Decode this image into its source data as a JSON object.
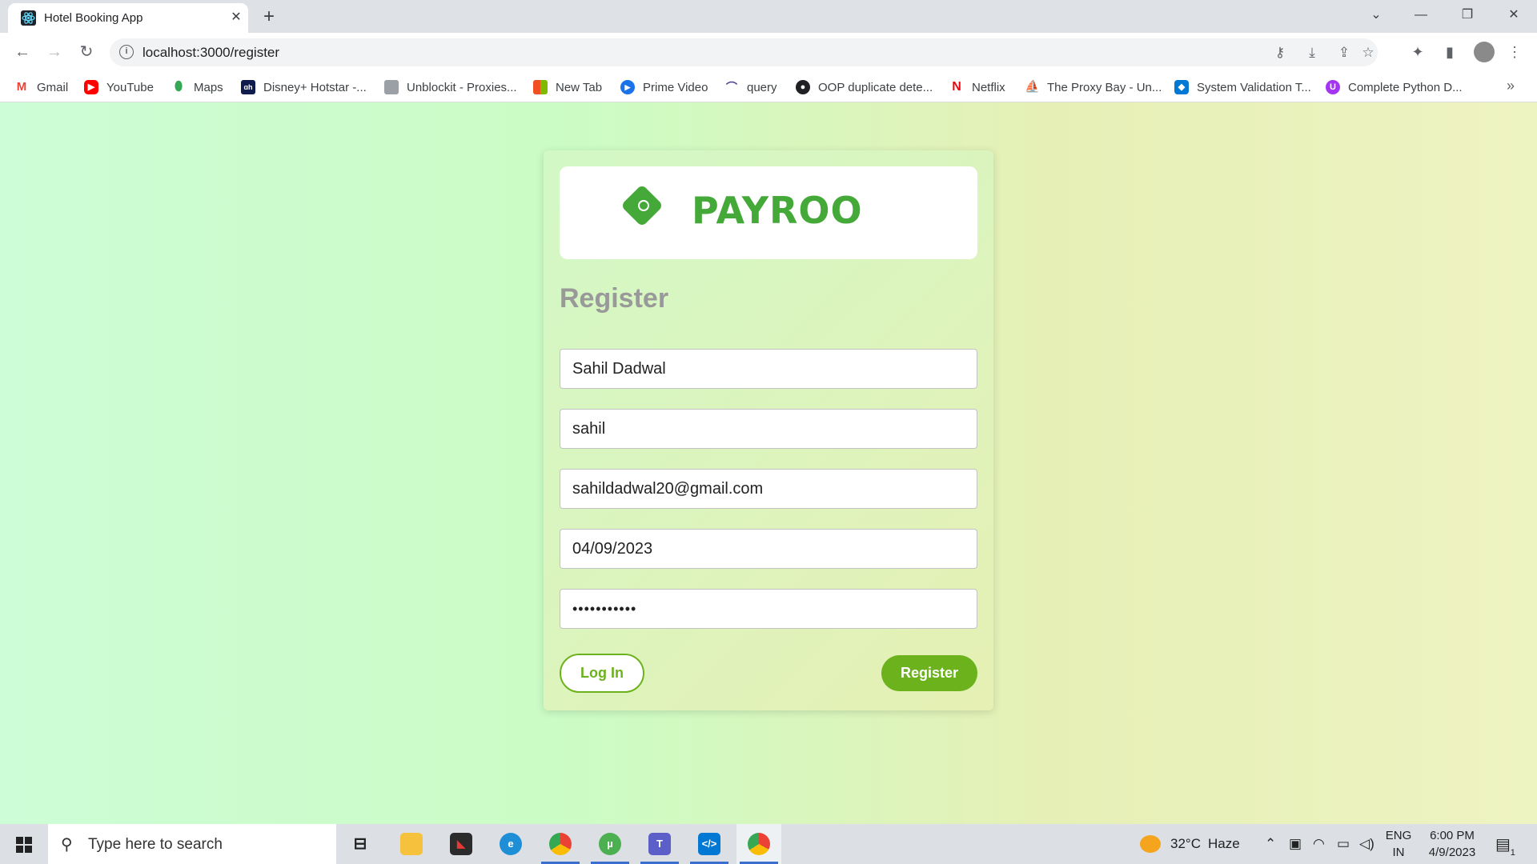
{
  "browser": {
    "tab_title": "Hotel Booking App",
    "url": "localhost:3000/register",
    "bookmarks": [
      {
        "label": "Gmail",
        "icon": "gmail-icon",
        "color": "#ea4335"
      },
      {
        "label": "YouTube",
        "icon": "youtube-icon",
        "color": "#ff0000"
      },
      {
        "label": "Maps",
        "icon": "maps-icon",
        "color": "#34a853"
      },
      {
        "label": "Disney+ Hotstar -...",
        "icon": "hotstar-icon",
        "color": "#0f1c4d"
      },
      {
        "label": "Unblockit - Proxies...",
        "icon": "unblockit-icon",
        "color": "#9aa0a6"
      },
      {
        "label": "New Tab",
        "icon": "windows-tiles-icon",
        "color": "#00a4ef"
      },
      {
        "label": "Prime Video",
        "icon": "prime-video-icon",
        "color": "#1a73e8"
      },
      {
        "label": "query",
        "icon": "query-icon",
        "color": "#4b3b8f"
      },
      {
        "label": "OOP duplicate dete...",
        "icon": "github-icon",
        "color": "#202124"
      },
      {
        "label": "Netflix",
        "icon": "netflix-icon",
        "color": "#e50914"
      },
      {
        "label": "The Proxy Bay - Un...",
        "icon": "pirate-ship-icon",
        "color": "#202124"
      },
      {
        "label": "System Validation T...",
        "icon": "azure-icon",
        "color": "#0078d4"
      },
      {
        "label": "Complete Python D...",
        "icon": "udemy-icon",
        "color": "#a435f0"
      }
    ]
  },
  "app": {
    "logo_text": "PAYROO",
    "form_title": "Register",
    "fields": {
      "name": "Sahil Dadwal",
      "username": "sahil",
      "email": "sahildadwal20@gmail.com",
      "date": "04/09/2023",
      "password": "•••••••••••"
    },
    "login_label": "Log In",
    "register_label": "Register",
    "accent_color": "#6cb21c",
    "logo_color": "#45a93a"
  },
  "taskbar": {
    "search_placeholder": "Type here to search",
    "weather_temp": "32°C",
    "weather_text": "Haze",
    "lang_top": "ENG",
    "lang_bottom": "IN",
    "time": "6:00 PM",
    "date": "4/9/2023",
    "notification_count": "1"
  }
}
